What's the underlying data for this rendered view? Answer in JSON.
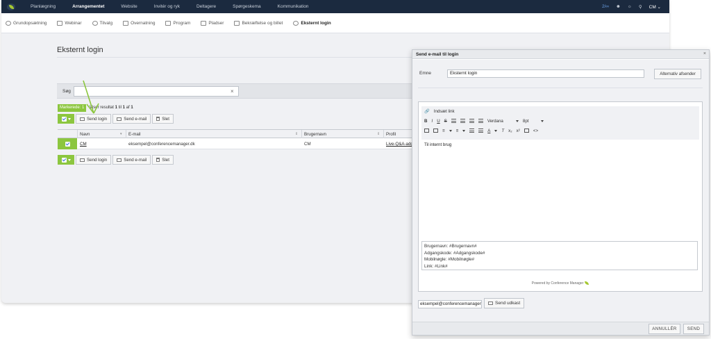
{
  "topnav": {
    "items": [
      "Planlægning",
      "Arrangementet",
      "Website",
      "Invitér og ryk",
      "Deltagere",
      "Spørgeskema",
      "Kommunikation"
    ],
    "active_index": 1,
    "count": "2/∞",
    "user": "CM"
  },
  "subnav": {
    "items": [
      "Grundopsætning",
      "Webinar",
      "Tilvalg",
      "Overnatning",
      "Program",
      "Pladser",
      "Bekræftelse og billet",
      "Eksternt login"
    ],
    "active_index": 7
  },
  "page": {
    "title": "Eksternt login",
    "search_label": "Søg",
    "search_value": "",
    "marked_label": "Markerede: 1",
    "result_prefix": "Viser resultat",
    "result_from": "1",
    "result_to_word": "til",
    "result_to": "1",
    "result_of_word": "af",
    "result_total": "1"
  },
  "toolbar": {
    "send_login": "Send login",
    "send_email": "Send e-mail",
    "delete": "Slet"
  },
  "table": {
    "headers": [
      "Navn",
      "E-mail",
      "Brugernavn",
      "Profil"
    ],
    "rows": [
      {
        "name": "CM",
        "email": "eksempel@conferencemanager.dk",
        "username": "CM",
        "profile": "Live-Q&A-adg"
      }
    ]
  },
  "modal": {
    "title": "Send e-mail til login",
    "subject_label": "Emne",
    "subject_value": "Eksternt login",
    "alt_sender": "Alternativ afsender",
    "insert_link": "Indsæt link",
    "font_name": "Verdana",
    "font_size": "8pt",
    "body_text": "Til internt brug",
    "vars": [
      "Brugernavn: #Brugernavn#",
      "Adgangskode: #Adgangskode#",
      "Mobilnøgle: #Mobilnøgle#",
      "Link: #Link#"
    ],
    "powered": "Powered by Conference Manager",
    "draft_email": "eksempel@conferencemanager.dk",
    "send_draft": "Send udkast",
    "cancel": "ANNULLÉR",
    "send": "SEND"
  },
  "colors": {
    "nav_bg": "#1b2a3f",
    "accent_green": "#8cc63f",
    "page_bg": "#f0f1f4"
  }
}
